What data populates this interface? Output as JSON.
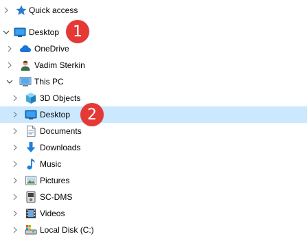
{
  "nav": {
    "quick_access": "Quick access",
    "desktop_top": "Desktop",
    "onedrive": "OneDrive",
    "user": "Vadim Sterkin",
    "this_pc": "This PC",
    "objects3d": "3D Objects",
    "desktop_pc": "Desktop",
    "documents": "Documents",
    "downloads": "Downloads",
    "music": "Music",
    "pictures": "Pictures",
    "scdms": "SC-DMS",
    "videos": "Videos",
    "localdisk": "Local Disk (C:)"
  },
  "annotations": {
    "badge1": "1",
    "badge2": "2"
  },
  "colors": {
    "selection": "#cce8ff",
    "badge": "#e53935",
    "icon_blue": "#1f7fd8",
    "chevron": "#808080"
  },
  "icons": {
    "quick_access": "star-pin-icon",
    "desktop": "desktop-icon",
    "onedrive": "cloud-icon",
    "user": "user-avatar-icon",
    "this_pc": "computer-icon",
    "objects3d": "cube-icon",
    "documents": "document-icon",
    "downloads": "download-arrow-icon",
    "music": "music-note-icon",
    "pictures": "pictures-icon",
    "scdms": "media-player-icon",
    "videos": "film-icon",
    "localdisk": "drive-icon"
  }
}
